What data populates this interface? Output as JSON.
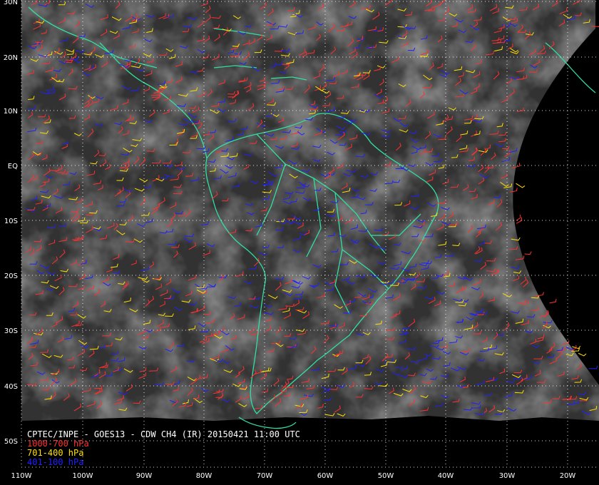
{
  "caption": {
    "title": "CPTEC/INPE - GOES13 - CDW CH4 (IR) 20150421 11:00 UTC",
    "legend": [
      {
        "label": "1000-700 hPa",
        "color": "#ff3030"
      },
      {
        "label": "701-400 hPa",
        "color": "#ffe000"
      },
      {
        "label": "401-100 hPa",
        "color": "#2020ff"
      }
    ]
  },
  "lat_labels": [
    "30N",
    "20N",
    "10N",
    "EQ",
    "10S",
    "20S",
    "30S",
    "40S",
    "50S"
  ],
  "lon_labels": [
    "110W",
    "100W",
    "90W",
    "80W",
    "70W",
    "60W",
    "50W",
    "40W",
    "30W",
    "20W"
  ],
  "colors": {
    "coastline": "#30e0a0",
    "grid": "#ffffff",
    "background": "#000000",
    "cloud": "#e8e8e8",
    "low_level": "#ff3030",
    "mid_level": "#ffe000",
    "high_level": "#2020ff"
  }
}
